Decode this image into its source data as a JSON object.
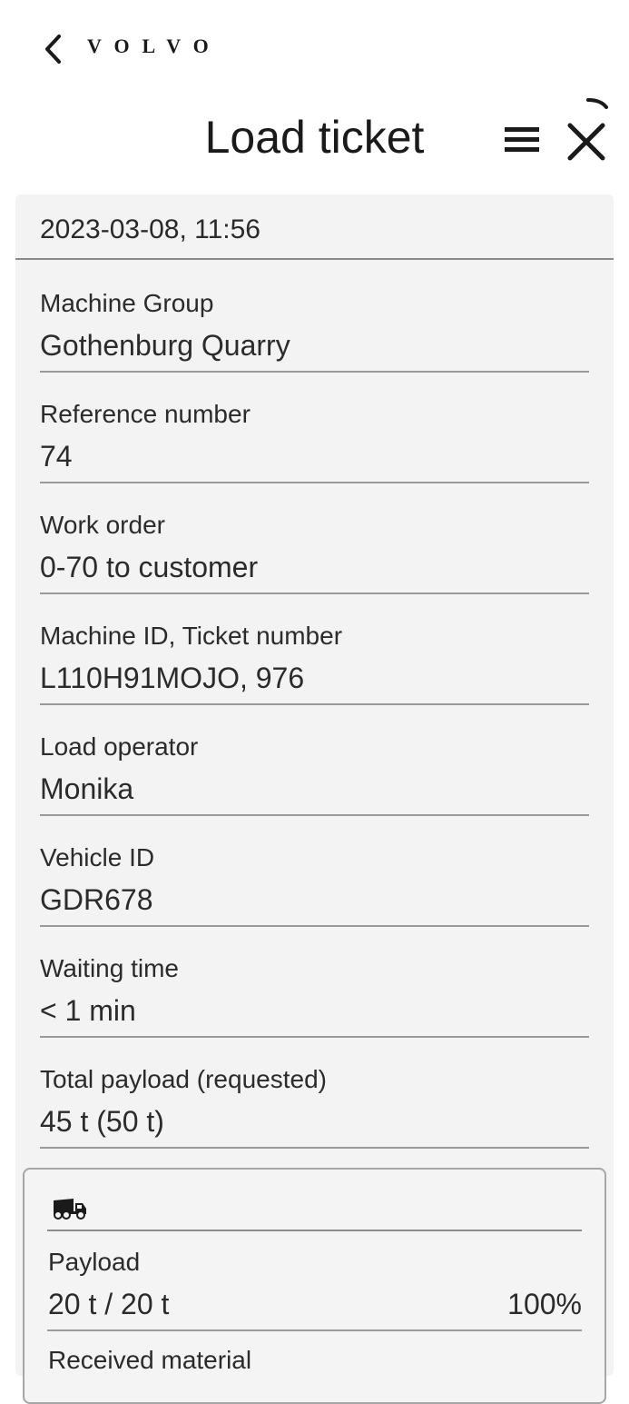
{
  "header": {
    "back_icon": "chevron-left-icon",
    "brand": "VOLVO",
    "title": "Load ticket",
    "menu_icon": "hamburger-menu-icon",
    "close_icon": "close-icon"
  },
  "ticket": {
    "date": "2023-03-08, 11:56",
    "fields": [
      {
        "label": "Machine Group",
        "value": "Gothenburg Quarry"
      },
      {
        "label": "Reference number",
        "value": "74"
      },
      {
        "label": "Work order",
        "value": "0-70 to customer"
      },
      {
        "label": "Machine ID, Ticket number",
        "value": "L110H91MOJO, 976"
      },
      {
        "label": "Load operator",
        "value": "Monika"
      },
      {
        "label": "Vehicle ID",
        "value": "GDR678"
      },
      {
        "label": "Waiting time",
        "value": "< 1 min"
      },
      {
        "label": "Total payload (requested)",
        "value": "45 t (50 t)"
      }
    ]
  },
  "load": {
    "vehicle_icon": "dump-truck-icon",
    "payload_label": "Payload",
    "payload_value": "20 t / 20 t",
    "payload_percent": "100%",
    "received_material_label": "Received material"
  }
}
